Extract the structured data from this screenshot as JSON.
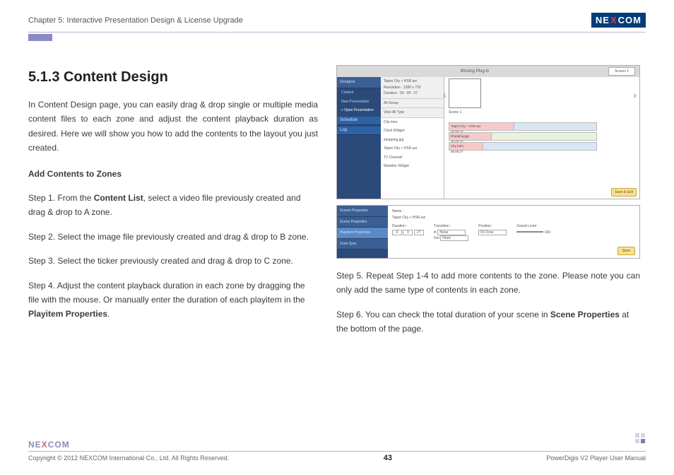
{
  "header": {
    "chapter": "Chapter 5: Interactive Presentation Design & License Upgrade",
    "brand_left": "NE",
    "brand_x": "X",
    "brand_right": "COM"
  },
  "main": {
    "heading": "5.1.3 Content Design",
    "intro": "In Content Design page, you can easily drag & drop single or multiple media content files to each zone and adjust the content playback duration as desired. Here we will show you how to add the contents to the layout you just created.",
    "subhead": "Add Contents to Zones",
    "step1_pre": "Step 1. From the ",
    "step1_bold": "Content List",
    "step1_post": ", select a video file previously created and drag & drop to A zone.",
    "step2": "Step 2. Select the image file previously created and drag & drop to B zone.",
    "step3": "Step 3. Select the ticker previously created and drag & drop to C zone.",
    "step4_pre": "Step 4. Adjust the content playback duration in each zone by dragging the file with the mouse. Or manually enter the duration of each playitem in the ",
    "step4_bold": "Playitem Properties",
    "step4_post": ".",
    "step5": "Step 5. Repeat Step 1-4 to add more contents to the zone. Please note you can only add the same type of contents in each zone.",
    "step6_pre": "Step 6. You can check the total duration of your scene in ",
    "step6_bold": "Scene Properties",
    "step6_post": " at the bottom of the page."
  },
  "mock1": {
    "top_center": "Missing Plug-in",
    "top_right": "Screen 1",
    "sidebar": {
      "designer": "Designer",
      "content": "Content",
      "newp": "New Presentation",
      "openp": "» Open Presentation",
      "schedule": "Schedule",
      "log": "Log"
    },
    "mid": {
      "title": "Taipei City + HSR.avi",
      "res": "Resolution : 1280 x 720",
      "dur": "Duration : 00 : 00 : 27",
      "group": "All Group",
      "type": "View All Type",
      "items": [
        "City Intro",
        "Clock Widget",
        "shopping.jpg",
        "Taipei City + HSR.avi",
        "TV Channel",
        "Weather Widget"
      ]
    },
    "timeline": {
      "scene": "Scene 1",
      "bar1": "Taipei City + HSR.avi",
      "bar1_t": "00:00:27",
      "bar2": "shopping.jpg",
      "bar2_t": "00:00:27",
      "bar3": "City Intro",
      "bar3_t": "00:00:27",
      "save": "Save & Exit"
    }
  },
  "mock2": {
    "tabs": [
      "Screen Properties",
      "Scene Properties",
      "Playitem Properties",
      "Zone Sync"
    ],
    "name_lbl": "Name :",
    "name_val": "Taipei City + HSR.avi",
    "dur_lbl": "Duration :",
    "dur_h": "0",
    "dur_m": "0",
    "dur_s": "27",
    "trans_lbl": "Transition :",
    "in_lbl": "In",
    "in_val": "None",
    "out_lbl": "Out",
    "out_val": "None",
    "pos_lbl": "Position :",
    "pos_val": "Fit Zone",
    "sound_lbl": "Sound Level :",
    "sound_val": "100",
    "save": "Save"
  },
  "footer": {
    "logo": "NEXCOM",
    "copy": "Copyright © 2012 NEXCOM International Co., Ltd. All Rights Reserved.",
    "page": "43",
    "product": "PowerDigis V2 Player User Manual"
  }
}
